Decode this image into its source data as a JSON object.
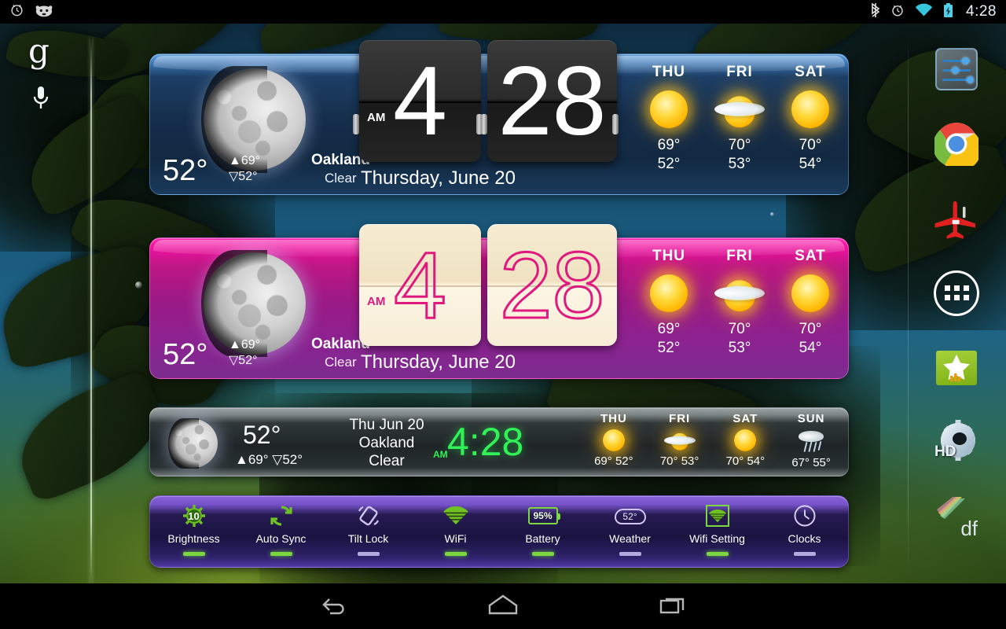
{
  "status_bar": {
    "left_icons": [
      "alarm-clock-icon",
      "android-jellybean-icon"
    ],
    "right_icons": [
      "bluetooth-icon",
      "alarm-clock-icon",
      "wifi-icon",
      "battery-charging-icon"
    ],
    "time": "4:28"
  },
  "google_search": {
    "g_glyph": "g",
    "mic_icon": "microphone-icon"
  },
  "nav_bar": {
    "back_label": "back-icon",
    "home_label": "home-icon",
    "recents_label": "recents-icon"
  },
  "dock": {
    "items": [
      {
        "name": "settings-sliders-icon",
        "label": ""
      },
      {
        "name": "chrome-icon",
        "label": ""
      },
      {
        "name": "airplane-icon",
        "label": ""
      },
      {
        "name": "app-drawer-icon",
        "label": ""
      },
      {
        "name": "star-app-icon",
        "label": ""
      },
      {
        "name": "settings-hd-icon",
        "label": "HD"
      },
      {
        "name": "df-app-icon",
        "label": "df"
      }
    ]
  },
  "widget_blue": {
    "theme_color": "#1d3f66",
    "accent_color": "#5f9fdc",
    "temp_now": "52°",
    "high": "▲69°",
    "low": "▽52°",
    "city": "Oakland",
    "condition": "Clear",
    "moon_icon": "moon-icon",
    "clock": {
      "hour": "4",
      "minute": "28",
      "ampm": "AM"
    },
    "date_text": "Thursday, June 20",
    "forecast": [
      {
        "dow": "THU",
        "icon": "sun-icon",
        "high": "69°",
        "low": "52°"
      },
      {
        "dow": "FRI",
        "icon": "partly-cloudy-icon",
        "high": "70°",
        "low": "53°"
      },
      {
        "dow": "SAT",
        "icon": "sun-icon",
        "high": "70°",
        "low": "54°"
      }
    ]
  },
  "widget_pink": {
    "theme_color": "#bd1785",
    "accent_color": "#ff22b0",
    "temp_now": "52°",
    "high": "▲69°",
    "low": "▽52°",
    "city": "Oakland",
    "condition": "Clear",
    "moon_icon": "moon-icon",
    "clock": {
      "hour": "4",
      "minute": "28",
      "ampm": "AM"
    },
    "date_text": "Thursday, June 20",
    "forecast": [
      {
        "dow": "THU",
        "icon": "sun-icon",
        "high": "69°",
        "low": "52°"
      },
      {
        "dow": "FRI",
        "icon": "partly-cloudy-icon",
        "high": "70°",
        "low": "53°"
      },
      {
        "dow": "SAT",
        "icon": "sun-icon",
        "high": "70°",
        "low": "54°"
      }
    ]
  },
  "widget_slim": {
    "theme_color": "#1f2527",
    "digital_color": "#2ff257",
    "temp_now": "52°",
    "hilo": "▲69° ▽52°",
    "date_text": "Thu Jun 20",
    "city": "Oakland",
    "condition": "Clear",
    "moon_icon": "moon-icon",
    "clock_text": "4:28",
    "ampm": "AM",
    "forecast": [
      {
        "dow": "THU",
        "icon": "sun-icon",
        "temps": "69° 52°"
      },
      {
        "dow": "FRI",
        "icon": "partly-cloudy-icon",
        "temps": "70° 53°"
      },
      {
        "dow": "SAT",
        "icon": "sun-icon",
        "temps": "70° 54°"
      },
      {
        "dow": "SUN",
        "icon": "rain-icon",
        "temps": "67° 55°"
      }
    ]
  },
  "widget_toggles": {
    "on_color": "#7bd63f",
    "off_color": "#b3a9e0",
    "items": [
      {
        "label": "Brightness",
        "icon": "brightness-icon",
        "value": "10",
        "state": "on"
      },
      {
        "label": "Auto Sync",
        "icon": "sync-icon",
        "value": "",
        "state": "on"
      },
      {
        "label": "Tilt Lock",
        "icon": "rotation-lock-icon",
        "value": "",
        "state": "off"
      },
      {
        "label": "WiFi",
        "icon": "wifi-icon",
        "value": "",
        "state": "on"
      },
      {
        "label": "Battery",
        "icon": "battery-icon",
        "value": "95%",
        "state": "on"
      },
      {
        "label": "Weather",
        "icon": "cloud-icon",
        "value": "52°",
        "state": "off"
      },
      {
        "label": "Wifi Setting",
        "icon": "wifi-settings-icon",
        "value": "",
        "state": "on"
      },
      {
        "label": "Clocks",
        "icon": "clock-icon",
        "value": "",
        "state": "off"
      }
    ]
  }
}
